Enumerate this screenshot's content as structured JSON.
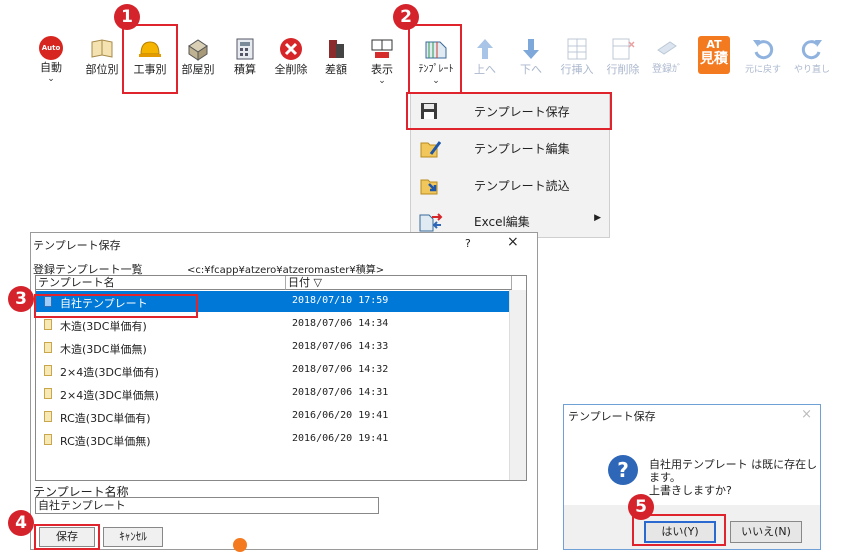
{
  "toolbar": {
    "buttons": [
      {
        "label": "自動",
        "icon": "auto-icon",
        "icon_text": "Auto",
        "dropdown": true
      },
      {
        "label": "部位別",
        "icon": "book-icon"
      },
      {
        "label": "工事別",
        "icon": "hardhat-icon"
      },
      {
        "label": "部屋別",
        "icon": "room-icon"
      },
      {
        "label": "積算",
        "icon": "calculator-icon"
      },
      {
        "label": "全削除",
        "icon": "delete-all-icon"
      },
      {
        "label": "差額",
        "icon": "difference-icon"
      },
      {
        "label": "表示",
        "icon": "display-icon",
        "dropdown": true
      },
      {
        "label": "ﾃﾝﾌﾟﾚｰﾄ",
        "icon": "template-icon",
        "dropdown": true
      },
      {
        "label": "上へ",
        "icon": "arrow-up-icon",
        "disabled": true
      },
      {
        "label": "下へ",
        "icon": "arrow-down-icon",
        "disabled": true
      },
      {
        "label": "行挿入",
        "icon": "insert-row-icon",
        "disabled": true
      },
      {
        "label": "行削除",
        "icon": "delete-row-icon",
        "disabled": true
      },
      {
        "label": "登録ｶﾞ",
        "icon": "register-icon",
        "disabled": true
      },
      {
        "label": "見積",
        "icon": "estimate-icon",
        "icon_text": "AT"
      },
      {
        "label": "元に戻す",
        "icon": "undo-icon",
        "disabled": true
      },
      {
        "label": "やり直し",
        "icon": "redo-icon",
        "disabled": true
      }
    ]
  },
  "template_menu": {
    "items": [
      {
        "label": "テンプレート保存",
        "icon": "floppy-disk-icon"
      },
      {
        "label": "テンプレート編集",
        "icon": "folder-edit-icon"
      },
      {
        "label": "テンプレート読込",
        "icon": "folder-open-icon"
      },
      {
        "label": "Excel編集",
        "icon": "excel-transfer-icon",
        "submenu": true
      }
    ]
  },
  "save_dialog": {
    "title": "テンプレート保存",
    "help": "?",
    "close": "×",
    "list_caption": "登録テンプレート一覧",
    "list_path": "<c:¥fcapp¥atzero¥atzeromaster¥積算>",
    "columns": {
      "name": "テンプレート名",
      "date": "日付 ▽"
    },
    "rows": [
      {
        "name": "自社テンプレート",
        "date": "2018/07/10 17:59",
        "selected": true
      },
      {
        "name": "木造(3DC単価有)",
        "date": "2018/07/06 14:34"
      },
      {
        "name": "木造(3DC単価無)",
        "date": "2018/07/06 14:33"
      },
      {
        "name": "2×4造(3DC単価有)",
        "date": "2018/07/06 14:32"
      },
      {
        "name": "2×4造(3DC単価無)",
        "date": "2018/07/06 14:31"
      },
      {
        "name": "RC造(3DC単価有)",
        "date": "2016/06/20 19:41"
      },
      {
        "name": "RC造(3DC単価無)",
        "date": "2016/06/20 19:41"
      }
    ],
    "name_label": "テンプレート名称",
    "name_value": "自社テンプレート",
    "save_button": "保存",
    "cancel_button": "ｷｬﾝｾﾙ"
  },
  "confirm_dialog": {
    "title": "テンプレート保存",
    "close": "×",
    "icon": "question-icon",
    "message_line1": "自社用テンプレート は既に存在します。",
    "message_line2": "上書きしますか?",
    "yes_button": "はい(Y)",
    "no_button": "いいえ(N)"
  },
  "steps": [
    "1",
    "2",
    "3",
    "4",
    "5"
  ],
  "colors": {
    "highlight": "#e0242e",
    "step_badge": "#d5232b",
    "selection": "#0078d7",
    "accent_orange": "#f47a20"
  }
}
